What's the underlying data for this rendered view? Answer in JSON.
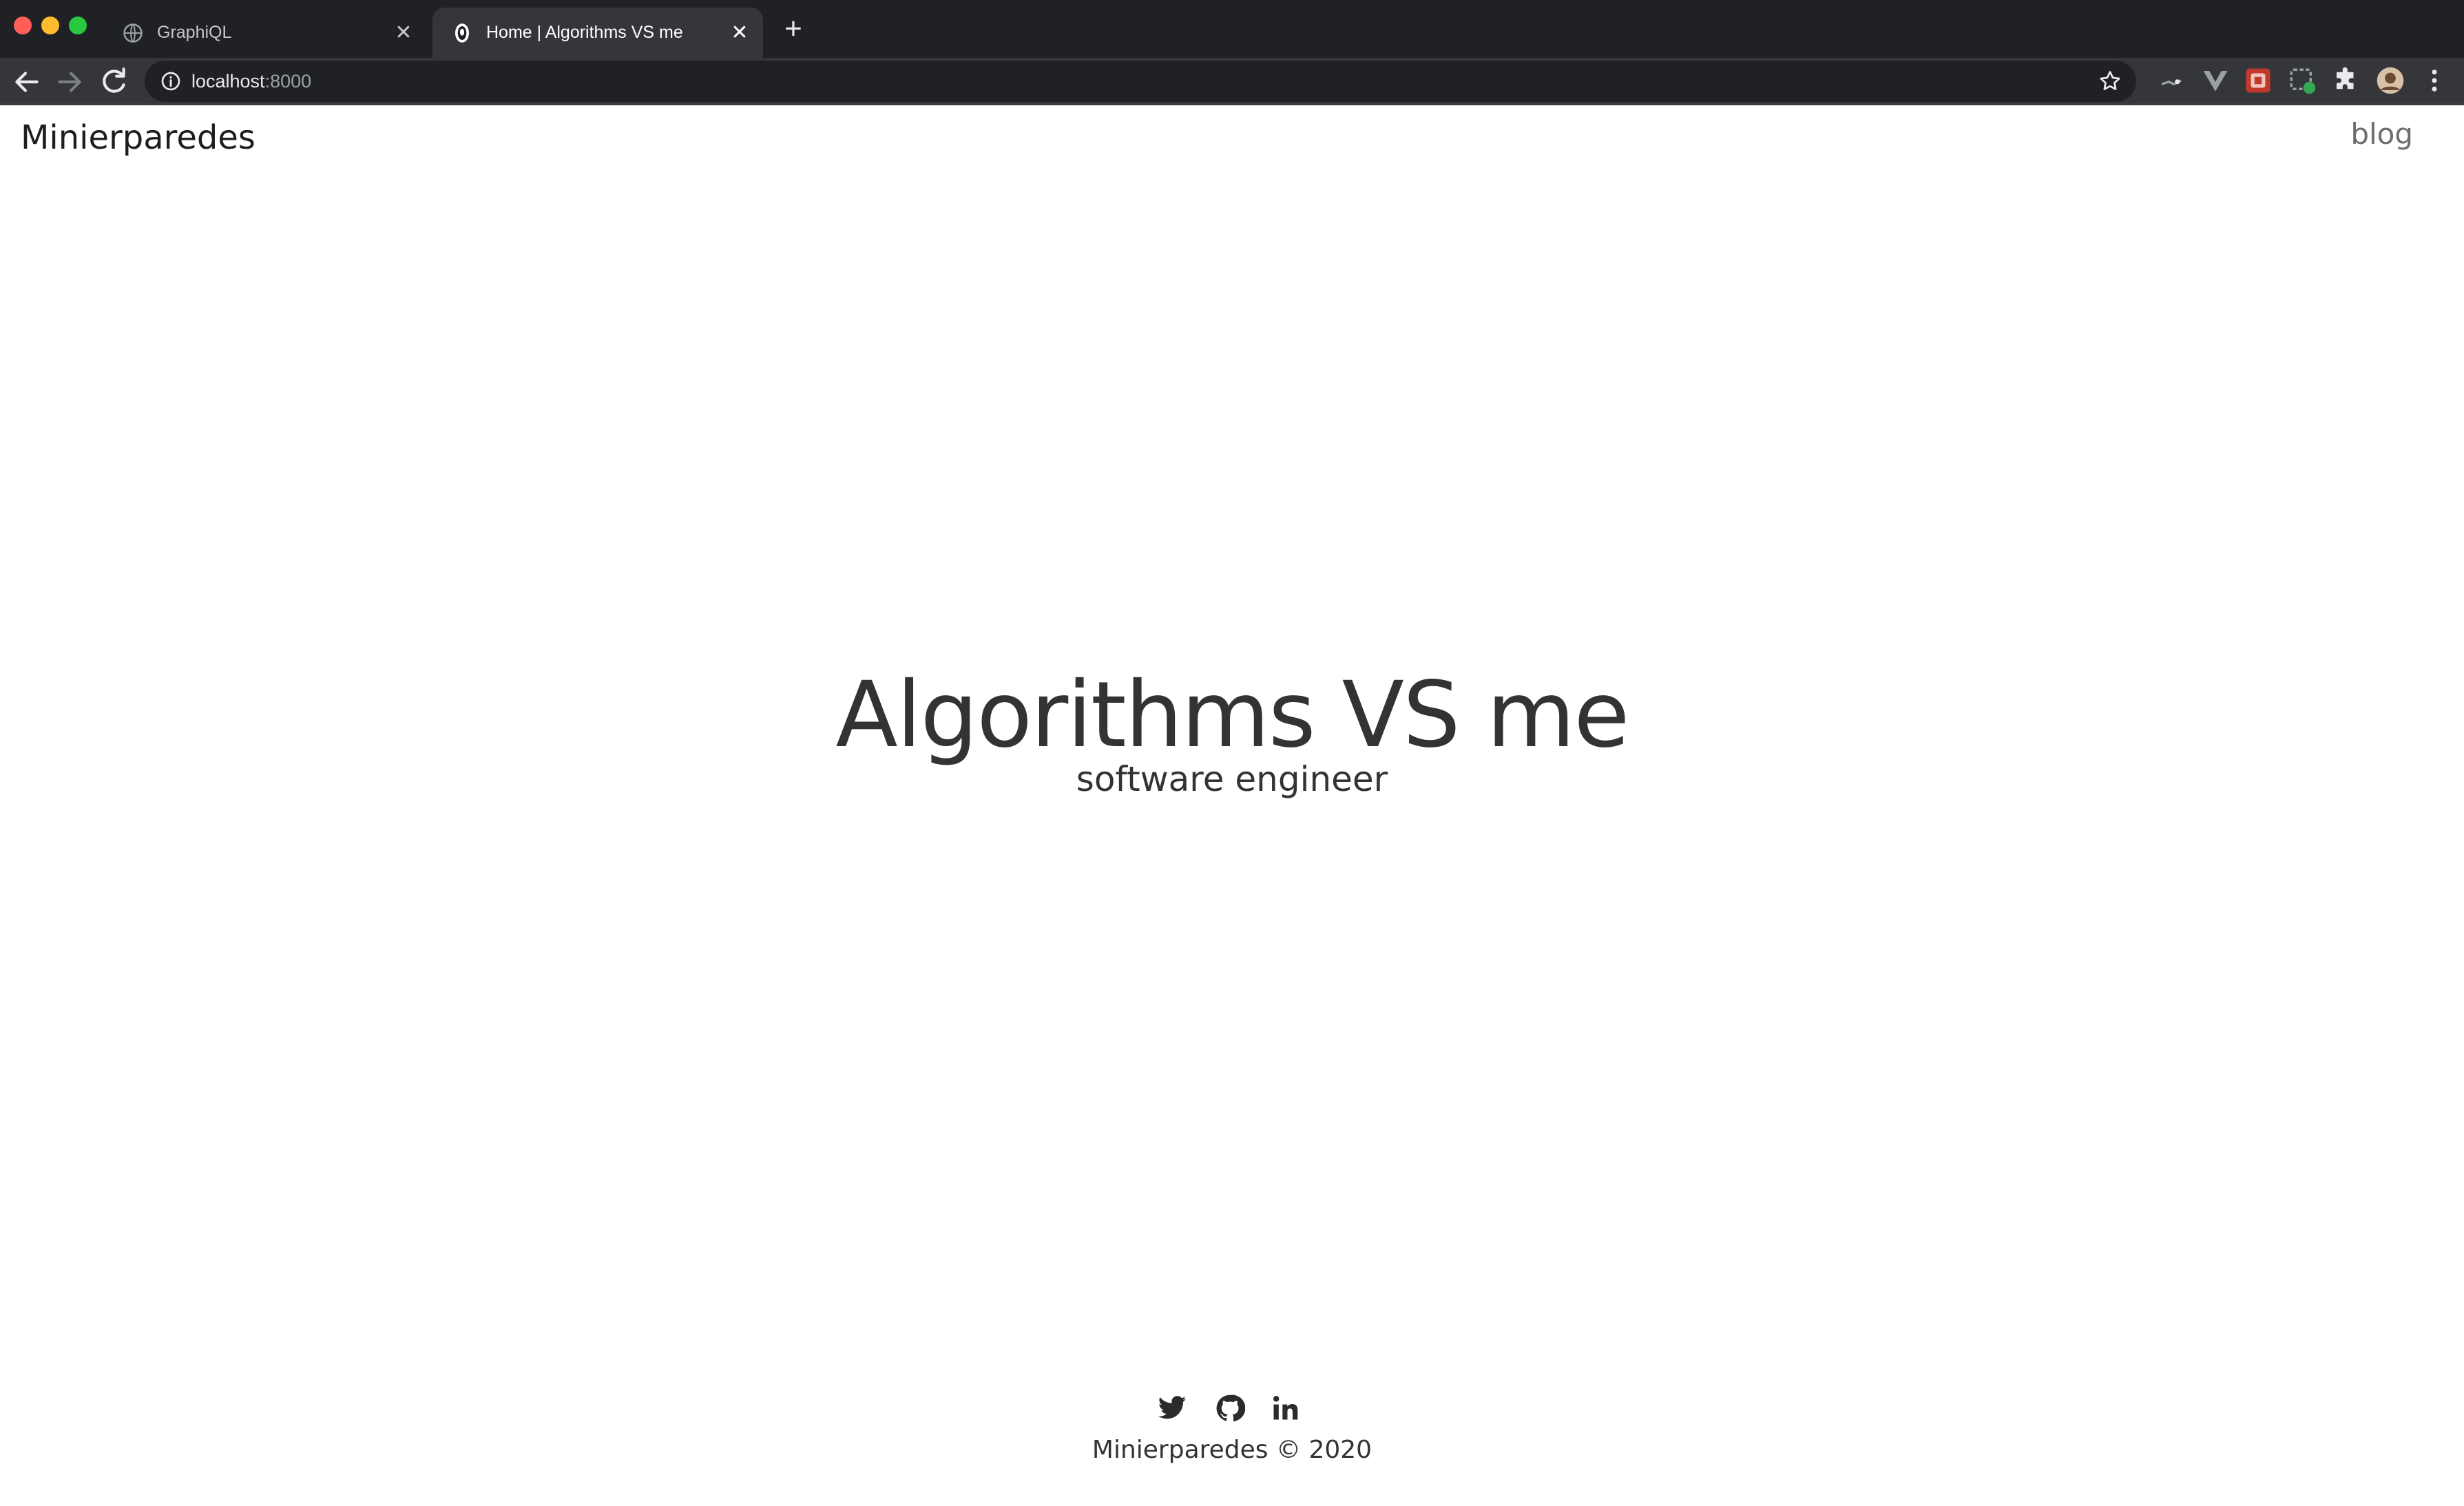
{
  "browser": {
    "tabs": [
      {
        "title": "GraphiQL",
        "close": "✕",
        "active": false
      },
      {
        "title": "Home | Algorithms VS me",
        "close": "✕",
        "active": true
      }
    ],
    "new_tab": "+",
    "url_host": "localhost",
    "url_port": ":8000",
    "extensions": [
      "extension-icon",
      "vue-devtools-icon",
      "extension-icon",
      "extension-icon",
      "puzzle-icon"
    ],
    "colors": {
      "chrome_dark": "#202124",
      "toolbar": "#35363a",
      "active_text": "#ffffff"
    }
  },
  "page": {
    "brand": "Minierparedes",
    "nav": {
      "blog": "blog"
    },
    "hero": {
      "title": "Algorithms VS me",
      "subtitle": "software engineer"
    },
    "social": [
      "twitter-icon",
      "github-icon",
      "linkedin-icon"
    ],
    "footer": "Minierparedes © 2020",
    "colors": {
      "text": "#333333",
      "nav": "#6d6d6d",
      "background": "#ffffff"
    }
  }
}
